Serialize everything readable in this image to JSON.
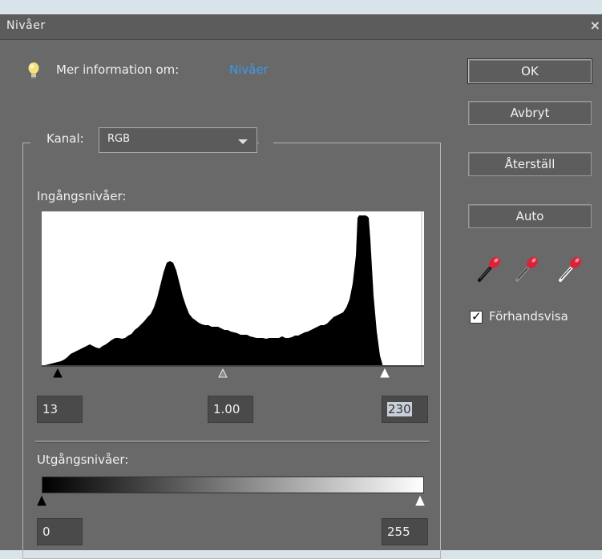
{
  "window": {
    "title": "Nivåer"
  },
  "info": {
    "label": "Mer information om:",
    "link": "Nivåer"
  },
  "channel": {
    "label": "Kanal:",
    "selected": "RGB"
  },
  "input": {
    "label": "Ingångsnivåer:",
    "black": "13",
    "gamma": "1.00",
    "white": "230"
  },
  "output": {
    "label": "Utgångsnivåer:",
    "black": "0",
    "white": "255"
  },
  "buttons": {
    "ok": "OK",
    "cancel": "Avbryt",
    "reset": "Återställ",
    "auto": "Auto"
  },
  "preview": {
    "label": "Förhandsvisa",
    "checked": true
  },
  "icons": [
    "lightbulb-icon",
    "close-icon",
    "chevron-down-icon",
    "black-eyedropper-icon",
    "gray-eyedropper-icon",
    "white-eyedropper-icon",
    "checkmark-icon"
  ],
  "colors": {
    "dialog_bg": "#696969",
    "link": "#3b9ae8",
    "dropper": "#d8243a"
  }
}
